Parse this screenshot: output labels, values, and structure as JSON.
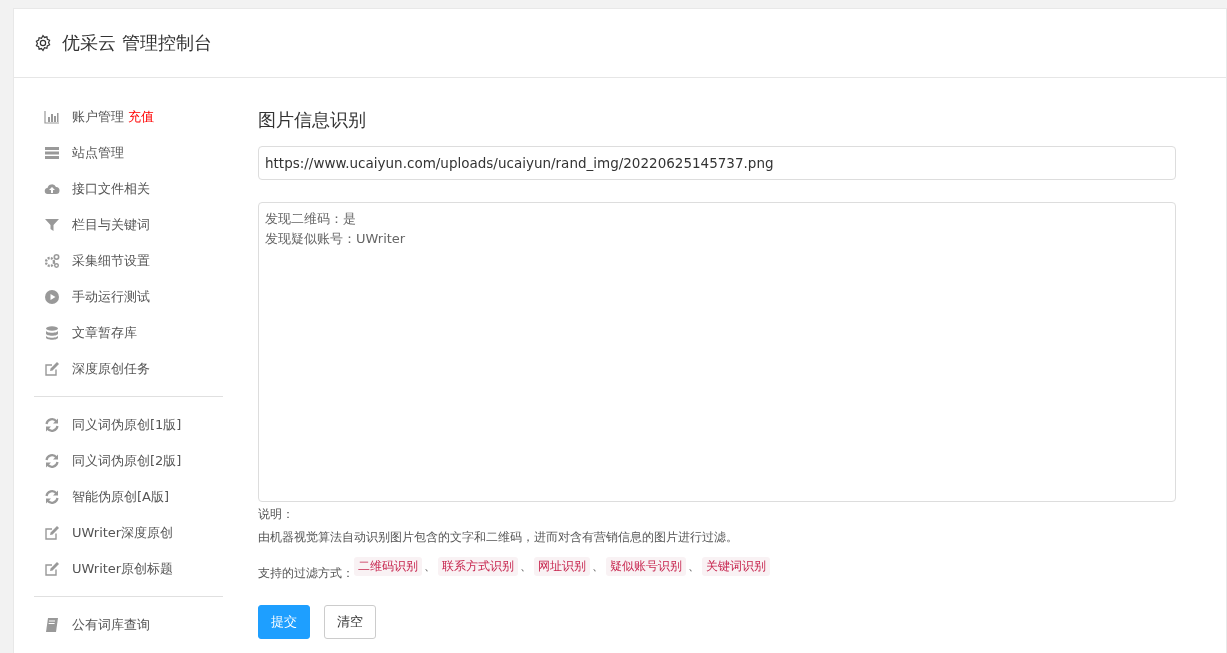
{
  "header": {
    "title": "优采云 管理控制台"
  },
  "sidebar": {
    "groups": [
      {
        "items": [
          {
            "label": "账户管理",
            "badge": "充值"
          },
          {
            "label": "站点管理"
          },
          {
            "label": "接口文件相关"
          },
          {
            "label": "栏目与关键词"
          },
          {
            "label": "采集细节设置"
          },
          {
            "label": "手动运行测试"
          },
          {
            "label": "文章暂存库"
          },
          {
            "label": "深度原创任务"
          }
        ]
      },
      {
        "items": [
          {
            "label": "同义词伪原创[1版]"
          },
          {
            "label": "同义词伪原创[2版]"
          },
          {
            "label": "智能伪原创[A版]"
          },
          {
            "label": "UWriter深度原创"
          },
          {
            "label": "UWriter原创标题"
          }
        ]
      },
      {
        "items": [
          {
            "label": "公有词库查询"
          }
        ]
      }
    ]
  },
  "main": {
    "title": "图片信息识别",
    "url_field": {
      "value": "https://www.ucaiyun.com/uploads/ucaiyun/rand_img/20220625145737.png"
    },
    "result_box": {
      "lines": [
        "发现二维码：是",
        "发现疑似账号：UWriter"
      ]
    },
    "notes": {
      "heading": "说明：",
      "description": "由机器视觉算法自动识别图片包含的文字和二维码，进而对含有营销信息的图片进行过滤。",
      "methods_label": "支持的过滤方式：",
      "separator": "、",
      "methods": [
        "二维码识别",
        "联系方式识别",
        "网址识别",
        "疑似账号识别",
        "关键词识别"
      ]
    },
    "buttons": [
      {
        "label": "提交",
        "kind": "primary"
      },
      {
        "label": "清空",
        "kind": "default"
      }
    ]
  }
}
